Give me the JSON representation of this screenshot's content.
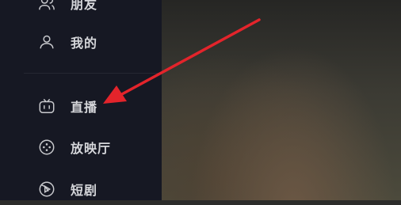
{
  "sidebar": {
    "items": [
      {
        "label": "朋友",
        "icon": "friends-icon"
      },
      {
        "label": "我的",
        "icon": "user-icon"
      },
      {
        "label": "直播",
        "icon": "tv-icon"
      },
      {
        "label": "放映厅",
        "icon": "film-reel-icon"
      },
      {
        "label": "短剧",
        "icon": "play-icon"
      }
    ]
  },
  "colors": {
    "sidebar_bg": "#161823",
    "text": "#d6d7db",
    "annotation_arrow": "#e3242b"
  }
}
